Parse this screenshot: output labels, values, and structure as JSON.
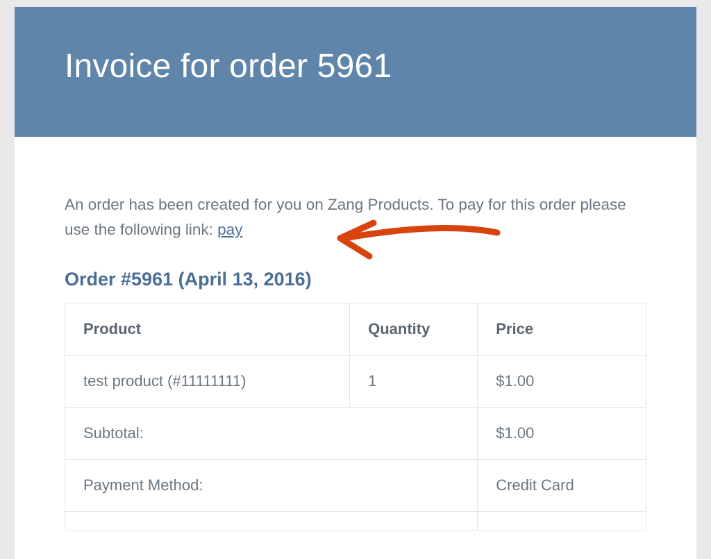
{
  "header": {
    "title": "Invoice for order 5961"
  },
  "intro": {
    "text_before": "An order has been created for you on Zang Products. To pay for this order please use the following link: ",
    "pay_link": "pay"
  },
  "order": {
    "heading": "Order #5961 (April 13, 2016)"
  },
  "table": {
    "headers": {
      "product": "Product",
      "quantity": "Quantity",
      "price": "Price"
    },
    "items": [
      {
        "product": "test product (#11111111)",
        "quantity": "1",
        "price": "$1.00"
      }
    ],
    "summary": [
      {
        "label": "Subtotal:",
        "value": "$1.00"
      },
      {
        "label": "Payment Method:",
        "value": "Credit Card"
      }
    ]
  }
}
